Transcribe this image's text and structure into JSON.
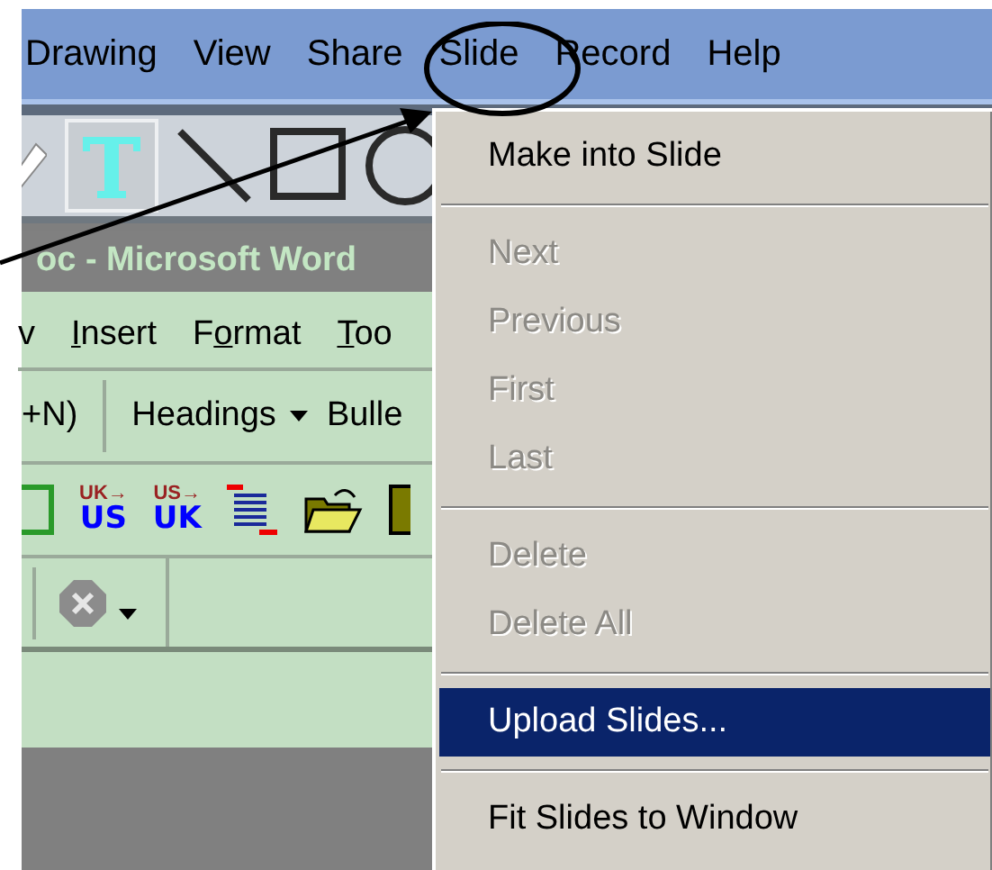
{
  "menu_bar": [
    {
      "label": "Drawing"
    },
    {
      "label": "View"
    },
    {
      "label": "Share"
    },
    {
      "label": "Slide"
    },
    {
      "label": "Record"
    },
    {
      "label": "Help"
    }
  ],
  "drawing_tools": [
    {
      "kind": "pencil",
      "selected": false
    },
    {
      "kind": "text",
      "selected": true
    },
    {
      "kind": "line",
      "selected": false
    },
    {
      "kind": "rectangle",
      "selected": false
    },
    {
      "kind": "ellipse",
      "selected": false
    }
  ],
  "word_window": {
    "title": "oc - Microsoft Word",
    "menu": [
      {
        "after": "v"
      },
      {
        "key": "I",
        "after": "nsert"
      },
      {
        "before": "F",
        "key": "o",
        "after": "rmat"
      },
      {
        "key": "T",
        "after": "oo"
      }
    ],
    "style_bar": [
      {
        "kind": "text",
        "label": "+N)"
      },
      {
        "kind": "separator"
      },
      {
        "kind": "dropdown",
        "label": "Headings"
      },
      {
        "kind": "text",
        "label": "Bulle"
      }
    ],
    "icons": [
      {
        "kind": "frame"
      },
      {
        "kind": "convert",
        "top": "UK→",
        "bottom": "US"
      },
      {
        "kind": "convert",
        "top": "US→",
        "bottom": "UK"
      },
      {
        "kind": "lines"
      },
      {
        "kind": "folder"
      },
      {
        "kind": "save"
      }
    ]
  },
  "slide_menu": [
    {
      "kind": "item",
      "label": "Make into Slide",
      "disabled": false,
      "selected": false
    },
    {
      "kind": "separator"
    },
    {
      "kind": "item",
      "label": "Next",
      "disabled": true,
      "selected": false
    },
    {
      "kind": "item",
      "label": "Previous",
      "disabled": true,
      "selected": false
    },
    {
      "kind": "item",
      "label": "First",
      "disabled": true,
      "selected": false
    },
    {
      "kind": "item",
      "label": "Last",
      "disabled": true,
      "selected": false
    },
    {
      "kind": "separator"
    },
    {
      "kind": "item",
      "label": "Delete",
      "disabled": true,
      "selected": false
    },
    {
      "kind": "item",
      "label": "Delete All",
      "disabled": true,
      "selected": false
    },
    {
      "kind": "separator"
    },
    {
      "kind": "item",
      "label": "Upload Slides...",
      "disabled": false,
      "selected": true
    },
    {
      "kind": "separator"
    },
    {
      "kind": "item",
      "label": "Fit Slides to Window",
      "disabled": false,
      "selected": false
    }
  ]
}
